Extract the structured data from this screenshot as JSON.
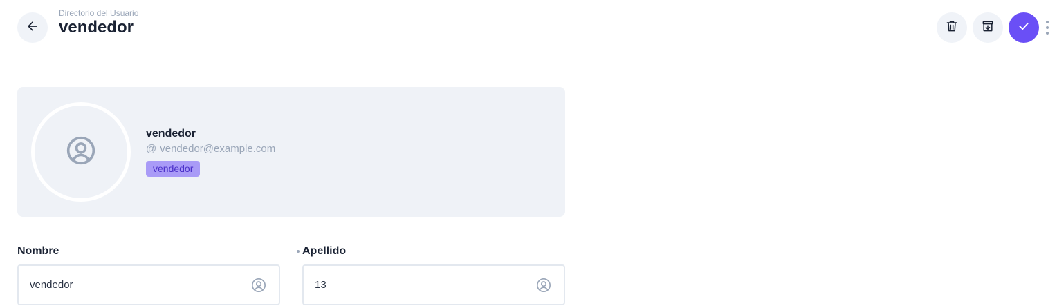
{
  "header": {
    "breadcrumb": "Directorio del Usuario",
    "title": "vendedor"
  },
  "icons": {
    "back": "arrow-left-icon",
    "delete": "trash-icon",
    "archive": "archive-download-icon",
    "save": "check-icon",
    "more": "more-vertical-icon",
    "avatar": "user-circle-icon",
    "email": "at-icon"
  },
  "profile": {
    "name": "vendedor",
    "at_symbol": "@",
    "email": "vendedor@example.com",
    "role": "vendedor"
  },
  "form": {
    "nombre": {
      "label": "Nombre",
      "value": "vendedor"
    },
    "apellido": {
      "label": "Apellido",
      "value": "13"
    }
  },
  "colors": {
    "accent": "#6a4ff6",
    "badge_bg": "#a99bf7",
    "card_bg": "#eff2f7",
    "muted": "#9aa6b8"
  }
}
